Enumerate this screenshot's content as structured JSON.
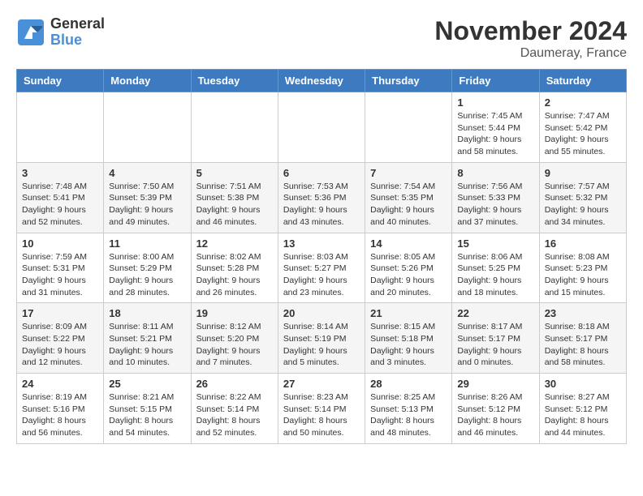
{
  "header": {
    "logo_line1": "General",
    "logo_line2": "Blue",
    "month": "November 2024",
    "location": "Daumeray, France"
  },
  "weekdays": [
    "Sunday",
    "Monday",
    "Tuesday",
    "Wednesday",
    "Thursday",
    "Friday",
    "Saturday"
  ],
  "weeks": [
    [
      {
        "day": "",
        "info": ""
      },
      {
        "day": "",
        "info": ""
      },
      {
        "day": "",
        "info": ""
      },
      {
        "day": "",
        "info": ""
      },
      {
        "day": "",
        "info": ""
      },
      {
        "day": "1",
        "info": "Sunrise: 7:45 AM\nSunset: 5:44 PM\nDaylight: 9 hours and 58 minutes."
      },
      {
        "day": "2",
        "info": "Sunrise: 7:47 AM\nSunset: 5:42 PM\nDaylight: 9 hours and 55 minutes."
      }
    ],
    [
      {
        "day": "3",
        "info": "Sunrise: 7:48 AM\nSunset: 5:41 PM\nDaylight: 9 hours and 52 minutes."
      },
      {
        "day": "4",
        "info": "Sunrise: 7:50 AM\nSunset: 5:39 PM\nDaylight: 9 hours and 49 minutes."
      },
      {
        "day": "5",
        "info": "Sunrise: 7:51 AM\nSunset: 5:38 PM\nDaylight: 9 hours and 46 minutes."
      },
      {
        "day": "6",
        "info": "Sunrise: 7:53 AM\nSunset: 5:36 PM\nDaylight: 9 hours and 43 minutes."
      },
      {
        "day": "7",
        "info": "Sunrise: 7:54 AM\nSunset: 5:35 PM\nDaylight: 9 hours and 40 minutes."
      },
      {
        "day": "8",
        "info": "Sunrise: 7:56 AM\nSunset: 5:33 PM\nDaylight: 9 hours and 37 minutes."
      },
      {
        "day": "9",
        "info": "Sunrise: 7:57 AM\nSunset: 5:32 PM\nDaylight: 9 hours and 34 minutes."
      }
    ],
    [
      {
        "day": "10",
        "info": "Sunrise: 7:59 AM\nSunset: 5:31 PM\nDaylight: 9 hours and 31 minutes."
      },
      {
        "day": "11",
        "info": "Sunrise: 8:00 AM\nSunset: 5:29 PM\nDaylight: 9 hours and 28 minutes."
      },
      {
        "day": "12",
        "info": "Sunrise: 8:02 AM\nSunset: 5:28 PM\nDaylight: 9 hours and 26 minutes."
      },
      {
        "day": "13",
        "info": "Sunrise: 8:03 AM\nSunset: 5:27 PM\nDaylight: 9 hours and 23 minutes."
      },
      {
        "day": "14",
        "info": "Sunrise: 8:05 AM\nSunset: 5:26 PM\nDaylight: 9 hours and 20 minutes."
      },
      {
        "day": "15",
        "info": "Sunrise: 8:06 AM\nSunset: 5:25 PM\nDaylight: 9 hours and 18 minutes."
      },
      {
        "day": "16",
        "info": "Sunrise: 8:08 AM\nSunset: 5:23 PM\nDaylight: 9 hours and 15 minutes."
      }
    ],
    [
      {
        "day": "17",
        "info": "Sunrise: 8:09 AM\nSunset: 5:22 PM\nDaylight: 9 hours and 12 minutes."
      },
      {
        "day": "18",
        "info": "Sunrise: 8:11 AM\nSunset: 5:21 PM\nDaylight: 9 hours and 10 minutes."
      },
      {
        "day": "19",
        "info": "Sunrise: 8:12 AM\nSunset: 5:20 PM\nDaylight: 9 hours and 7 minutes."
      },
      {
        "day": "20",
        "info": "Sunrise: 8:14 AM\nSunset: 5:19 PM\nDaylight: 9 hours and 5 minutes."
      },
      {
        "day": "21",
        "info": "Sunrise: 8:15 AM\nSunset: 5:18 PM\nDaylight: 9 hours and 3 minutes."
      },
      {
        "day": "22",
        "info": "Sunrise: 8:17 AM\nSunset: 5:17 PM\nDaylight: 9 hours and 0 minutes."
      },
      {
        "day": "23",
        "info": "Sunrise: 8:18 AM\nSunset: 5:17 PM\nDaylight: 8 hours and 58 minutes."
      }
    ],
    [
      {
        "day": "24",
        "info": "Sunrise: 8:19 AM\nSunset: 5:16 PM\nDaylight: 8 hours and 56 minutes."
      },
      {
        "day": "25",
        "info": "Sunrise: 8:21 AM\nSunset: 5:15 PM\nDaylight: 8 hours and 54 minutes."
      },
      {
        "day": "26",
        "info": "Sunrise: 8:22 AM\nSunset: 5:14 PM\nDaylight: 8 hours and 52 minutes."
      },
      {
        "day": "27",
        "info": "Sunrise: 8:23 AM\nSunset: 5:14 PM\nDaylight: 8 hours and 50 minutes."
      },
      {
        "day": "28",
        "info": "Sunrise: 8:25 AM\nSunset: 5:13 PM\nDaylight: 8 hours and 48 minutes."
      },
      {
        "day": "29",
        "info": "Sunrise: 8:26 AM\nSunset: 5:12 PM\nDaylight: 8 hours and 46 minutes."
      },
      {
        "day": "30",
        "info": "Sunrise: 8:27 AM\nSunset: 5:12 PM\nDaylight: 8 hours and 44 minutes."
      }
    ]
  ]
}
